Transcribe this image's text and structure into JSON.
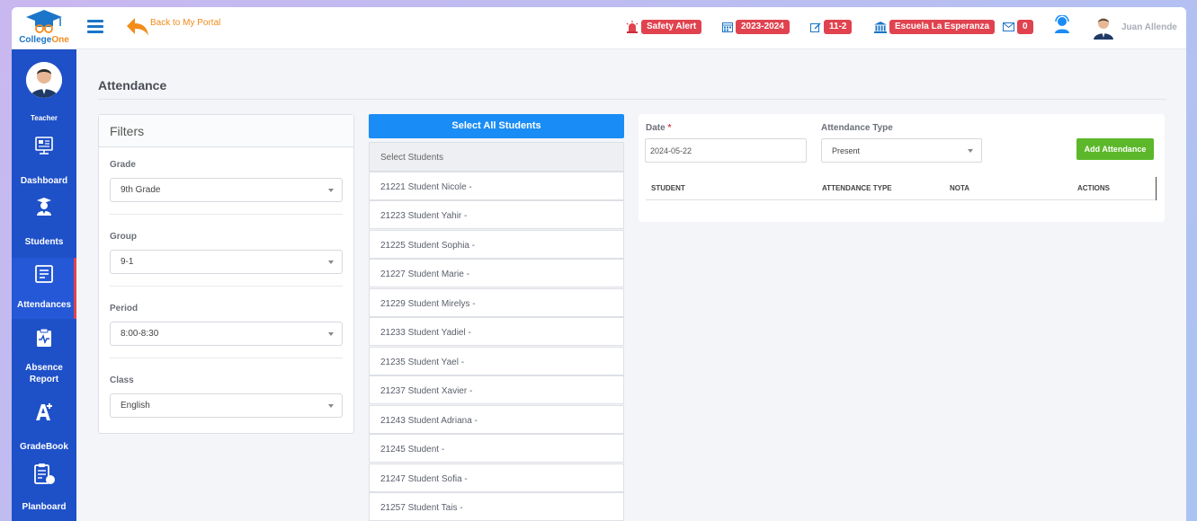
{
  "header": {
    "logo_text": "CollegeOne",
    "back_label": "Back to My Portal",
    "safety_alert": "Safety Alert",
    "school_year": "2023-2024",
    "grade_group": "11-2",
    "school_name": "Escuela La Esperanza",
    "messages_count": "0",
    "user_name": "Juan Allende"
  },
  "sidebar": {
    "role": "Teacher",
    "items": [
      {
        "label": "Dashboard",
        "icon": "dashboard-icon"
      },
      {
        "label": "Students",
        "icon": "student-icon"
      },
      {
        "label": "Attendances",
        "icon": "attendance-icon",
        "active": true
      },
      {
        "label": "Absence Report",
        "icon": "clipboard-heart-icon"
      },
      {
        "label": "GradeBook",
        "icon": "grade-icon"
      },
      {
        "label": "Planboard",
        "icon": "planboard-icon"
      }
    ]
  },
  "page": {
    "title": "Attendance"
  },
  "filters": {
    "title": "Filters",
    "grade": {
      "label": "Grade",
      "value": "9th Grade"
    },
    "group": {
      "label": "Group",
      "value": "9-1"
    },
    "period": {
      "label": "Period",
      "value": "8:00-8:30"
    },
    "class": {
      "label": "Class",
      "value": "English"
    }
  },
  "students": {
    "select_all_label": "Select All Students",
    "header": "Select Students",
    "items": [
      "21221 Student Nicole -",
      "21223 Student Yahir -",
      "21225 Student Sophia -",
      "21227 Student Marie -",
      "21229 Student Mirelys -",
      "21233 Student Yadiel -",
      "21235 Student Yael -",
      "21237 Student Xavier -",
      "21243 Student Adriana -",
      "21245 Student -",
      "21247 Student Sofia -",
      "21257 Student Tais -"
    ]
  },
  "attendance": {
    "date_label": "Date",
    "date_required": "*",
    "date_value": "2024-05-22",
    "type_label": "Attendance Type",
    "type_value": "Present",
    "add_button": "Add Attendance",
    "columns": [
      "STUDENT",
      "ATTENDANCE TYPE",
      "NOTA",
      "ACTIONS"
    ]
  },
  "colors": {
    "sidebar": "#1e50c8",
    "badge": "#e0434f",
    "primary_button": "#1a8cf5",
    "success_button": "#5cb82a",
    "accent_orange": "#f28c1b"
  }
}
